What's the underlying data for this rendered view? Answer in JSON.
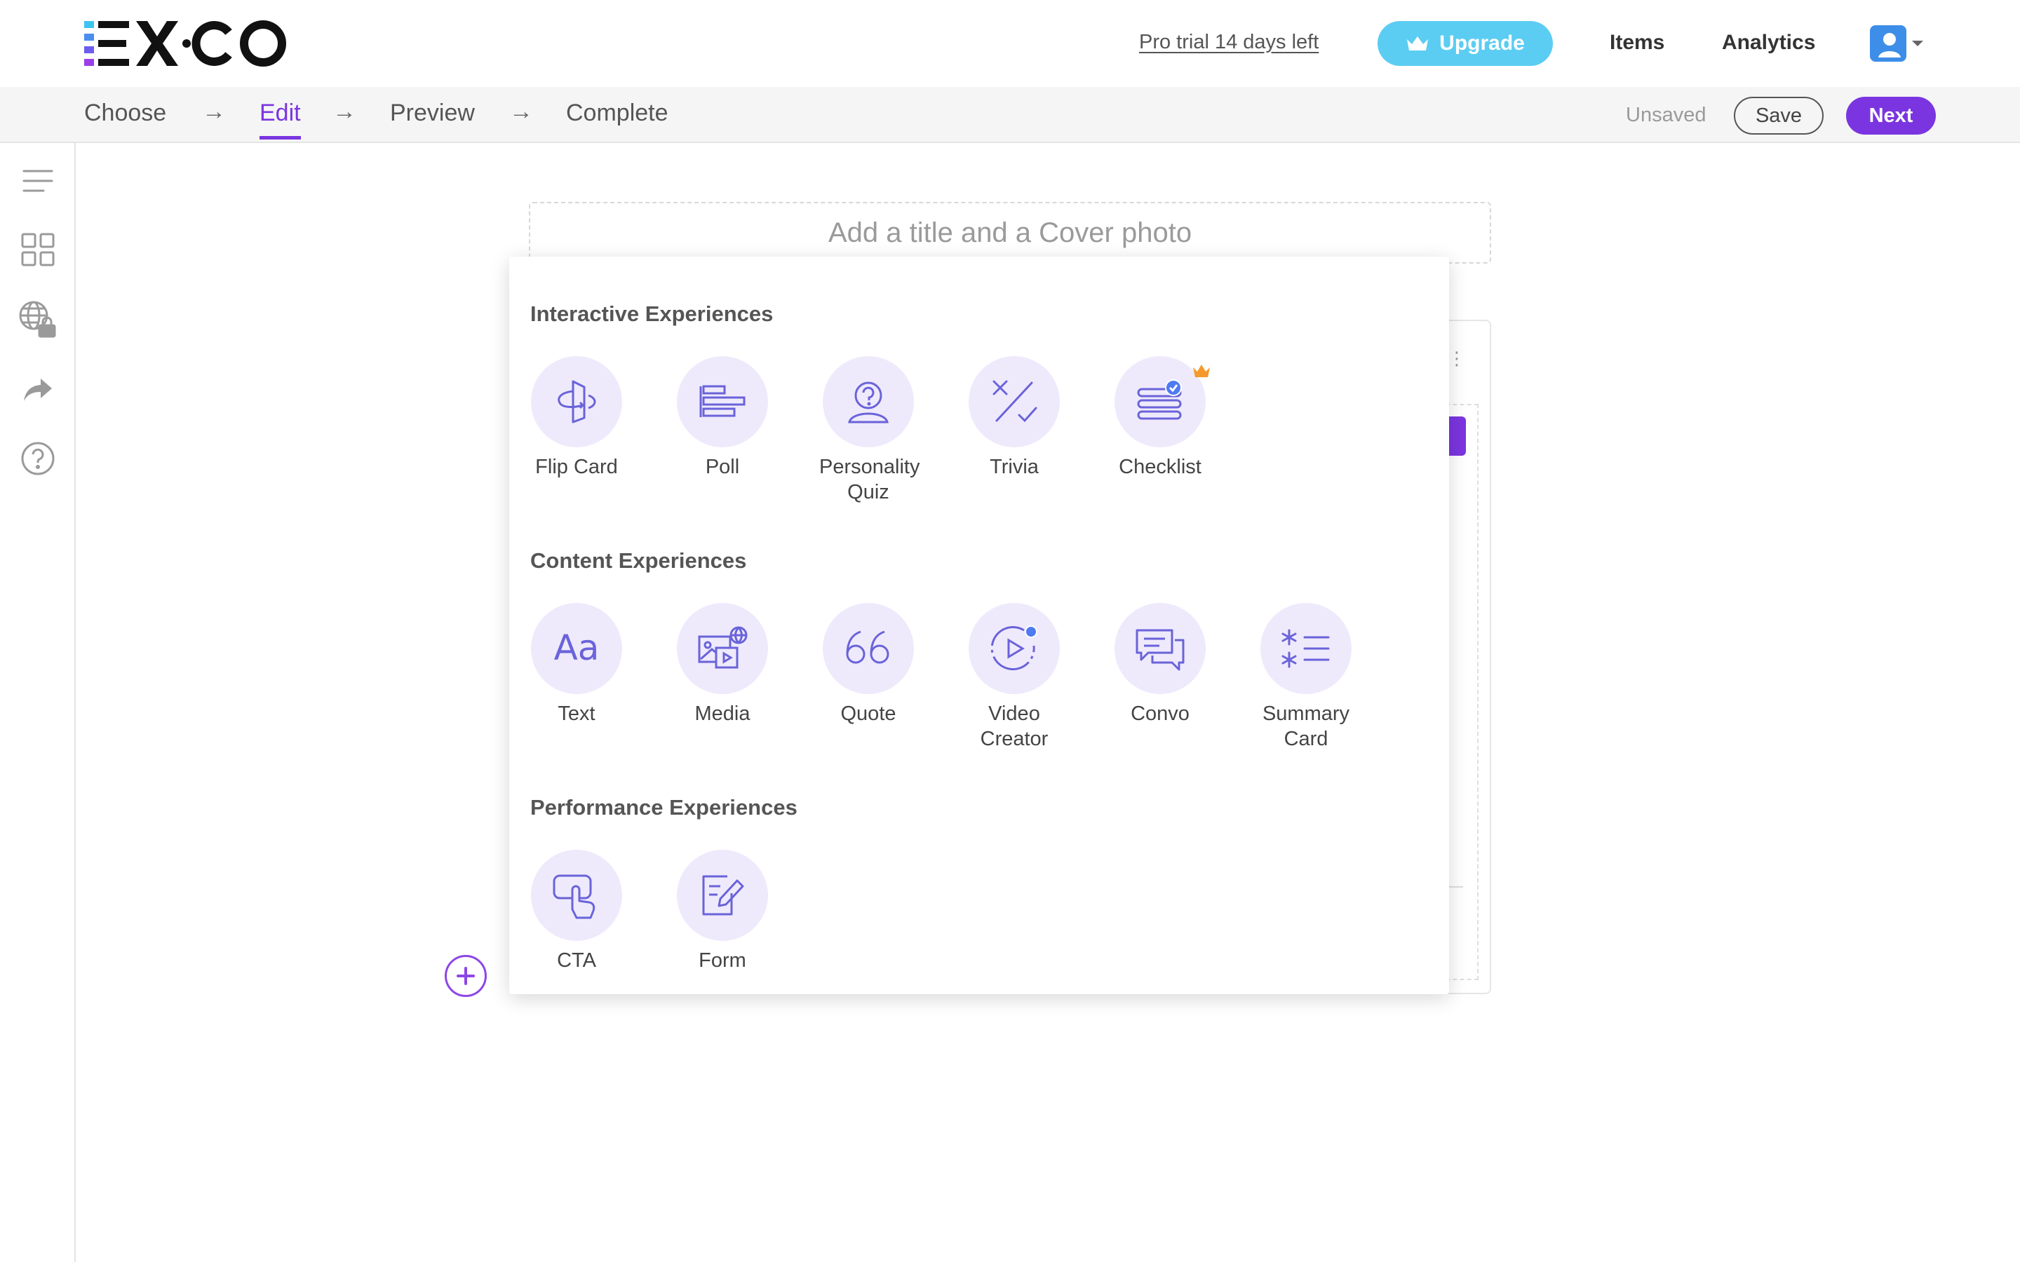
{
  "brand": {
    "accent": "#7b35e0",
    "upgrade_bg": "#5ccdf2",
    "icon_bg": "#eeeafc",
    "icon_stroke": "#6a63d9"
  },
  "header": {
    "logo_text": "EX·CO",
    "trial_link": "Pro trial 14 days left",
    "upgrade_label": "Upgrade",
    "nav": {
      "items": "Items",
      "analytics": "Analytics"
    }
  },
  "steps": [
    {
      "label": "Choose",
      "active": false
    },
    {
      "label": "Edit",
      "active": true
    },
    {
      "label": "Preview",
      "active": false
    },
    {
      "label": "Complete",
      "active": false
    }
  ],
  "step_arrow": "→",
  "toolbar": {
    "status": "Unsaved",
    "save_label": "Save",
    "next_label": "Next"
  },
  "sidebar": {
    "items": [
      {
        "icon": "menu-icon"
      },
      {
        "icon": "layout-grid-icon"
      },
      {
        "icon": "globe-lock-icon"
      },
      {
        "icon": "share-arrow-icon"
      },
      {
        "icon": "help-circle-icon"
      }
    ]
  },
  "canvas": {
    "title_placeholder": "Add a title and a Cover photo"
  },
  "menu": {
    "sections": [
      {
        "title": "Interactive Experiences",
        "items": [
          {
            "label": "Flip Card",
            "icon": "flip-card-icon"
          },
          {
            "label": "Poll",
            "icon": "poll-icon"
          },
          {
            "label": "Personality Quiz",
            "icon": "personality-quiz-icon"
          },
          {
            "label": "Trivia",
            "icon": "trivia-icon"
          },
          {
            "label": "Checklist",
            "icon": "checklist-icon",
            "premium": true
          }
        ]
      },
      {
        "title": "Content Experiences",
        "items": [
          {
            "label": "Text",
            "icon": "text-icon"
          },
          {
            "label": "Media",
            "icon": "media-icon"
          },
          {
            "label": "Quote",
            "icon": "quote-icon"
          },
          {
            "label": "Video Creator",
            "icon": "video-creator-icon"
          },
          {
            "label": "Convo",
            "icon": "convo-icon"
          },
          {
            "label": "Summary Card",
            "icon": "summary-card-icon"
          }
        ]
      },
      {
        "title": "Performance Experiences",
        "items": [
          {
            "label": "CTA",
            "icon": "cta-icon"
          },
          {
            "label": "Form",
            "icon": "form-icon"
          }
        ]
      }
    ]
  }
}
